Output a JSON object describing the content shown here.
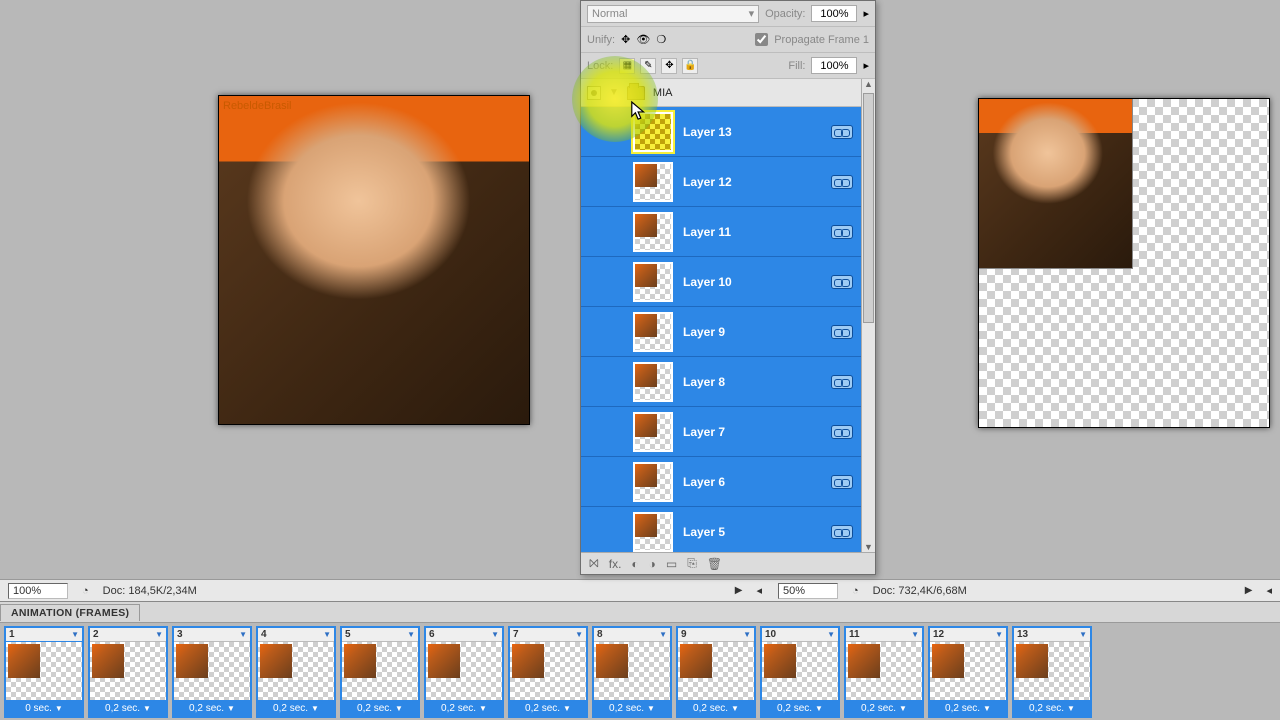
{
  "left_pane": {
    "zoom": "100%",
    "doc_size": "Doc: 184,5K/2,34M",
    "watermark": "RebeldeBrasil"
  },
  "right_pane": {
    "zoom": "50%",
    "doc_size": "Doc: 732,4K/6,68M"
  },
  "layers_panel": {
    "blend_mode": "Normal",
    "opacity_label": "Opacity:",
    "opacity_value": "100%",
    "unify_label": "Unify:",
    "propagate_label": "Propagate Frame 1",
    "lock_label": "Lock:",
    "fill_label": "Fill:",
    "fill_value": "100%",
    "group_name": "MIA",
    "layers": [
      {
        "name": "Layer 13"
      },
      {
        "name": "Layer 12"
      },
      {
        "name": "Layer 11"
      },
      {
        "name": "Layer 10"
      },
      {
        "name": "Layer 9"
      },
      {
        "name": "Layer 8"
      },
      {
        "name": "Layer 7"
      },
      {
        "name": "Layer 6"
      },
      {
        "name": "Layer 5"
      }
    ]
  },
  "animation_panel": {
    "tab_label": "ANIMATION (FRAMES)",
    "frames": [
      {
        "n": "1",
        "delay": "0 sec."
      },
      {
        "n": "2",
        "delay": "0,2 sec."
      },
      {
        "n": "3",
        "delay": "0,2 sec."
      },
      {
        "n": "4",
        "delay": "0,2 sec."
      },
      {
        "n": "5",
        "delay": "0,2 sec."
      },
      {
        "n": "6",
        "delay": "0,2 sec."
      },
      {
        "n": "7",
        "delay": "0,2 sec."
      },
      {
        "n": "8",
        "delay": "0,2 sec."
      },
      {
        "n": "9",
        "delay": "0,2 sec."
      },
      {
        "n": "10",
        "delay": "0,2 sec."
      },
      {
        "n": "11",
        "delay": "0,2 sec."
      },
      {
        "n": "12",
        "delay": "0,2 sec."
      },
      {
        "n": "13",
        "delay": "0,2 sec."
      }
    ]
  },
  "footer_icons": {
    "link": "⨝",
    "fx": "fx.",
    "mask": "◐",
    "adj": "◑",
    "group": "▭",
    "new": "⎘",
    "trash": "🗑"
  }
}
